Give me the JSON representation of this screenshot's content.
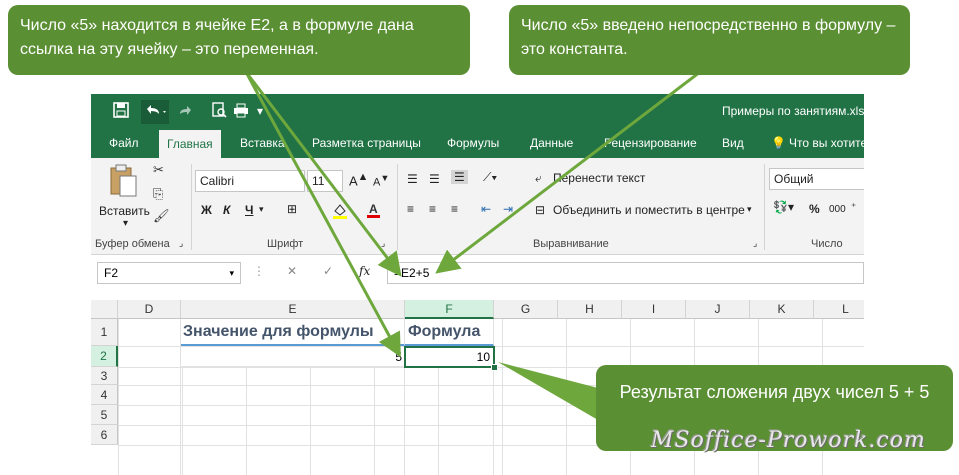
{
  "callouts": {
    "left": "Число «5» находится в ячейке E2, а в формуле дана ссылка на эту ячейку – это переменная.",
    "right": "Число «5» введено непосредственно в формулу – это константа.",
    "result": "Результат сложения двух чисел 5 + 5"
  },
  "window": {
    "title": "Примеры по занятиям.xls"
  },
  "tabs": [
    "Файл",
    "Главная",
    "Вставка",
    "Разметка страницы",
    "Формулы",
    "Данные",
    "Рецензирование",
    "Вид",
    "Что вы хотите"
  ],
  "ribbon": {
    "paste_label": "Вставить",
    "clipboard_label": "Буфер обмена",
    "font_label": "Шрифт",
    "alignment_label": "Выравнивание",
    "number_label": "Число",
    "font_name": "Calibri",
    "font_size": "11",
    "bold": "Ж",
    "italic": "К",
    "underline": "Ч",
    "wrap_text": "Перенести текст",
    "merge_center": "Объединить и поместить в центре",
    "number_format": "Общий",
    "percent": "%",
    "thousands": "000"
  },
  "formula_bar": {
    "name_box": "F2",
    "fx": "fx",
    "formula": "=E2+5"
  },
  "sheet": {
    "columns": [
      "D",
      "E",
      "F",
      "G",
      "H",
      "I",
      "J",
      "K",
      "L"
    ],
    "rows": [
      "1",
      "2",
      "3",
      "4",
      "5",
      "6"
    ],
    "e1": "Значение для формулы",
    "f1": "Формула",
    "e2": "5",
    "f2": "10"
  },
  "watermark": "MSoffice-Prowork.com",
  "colors": {
    "excel_green": "#217346",
    "callout_green": "#5b8f34",
    "arrow_green": "#6ea83d",
    "header_blue": "#44546a",
    "underline_blue": "#5b9bd5"
  }
}
